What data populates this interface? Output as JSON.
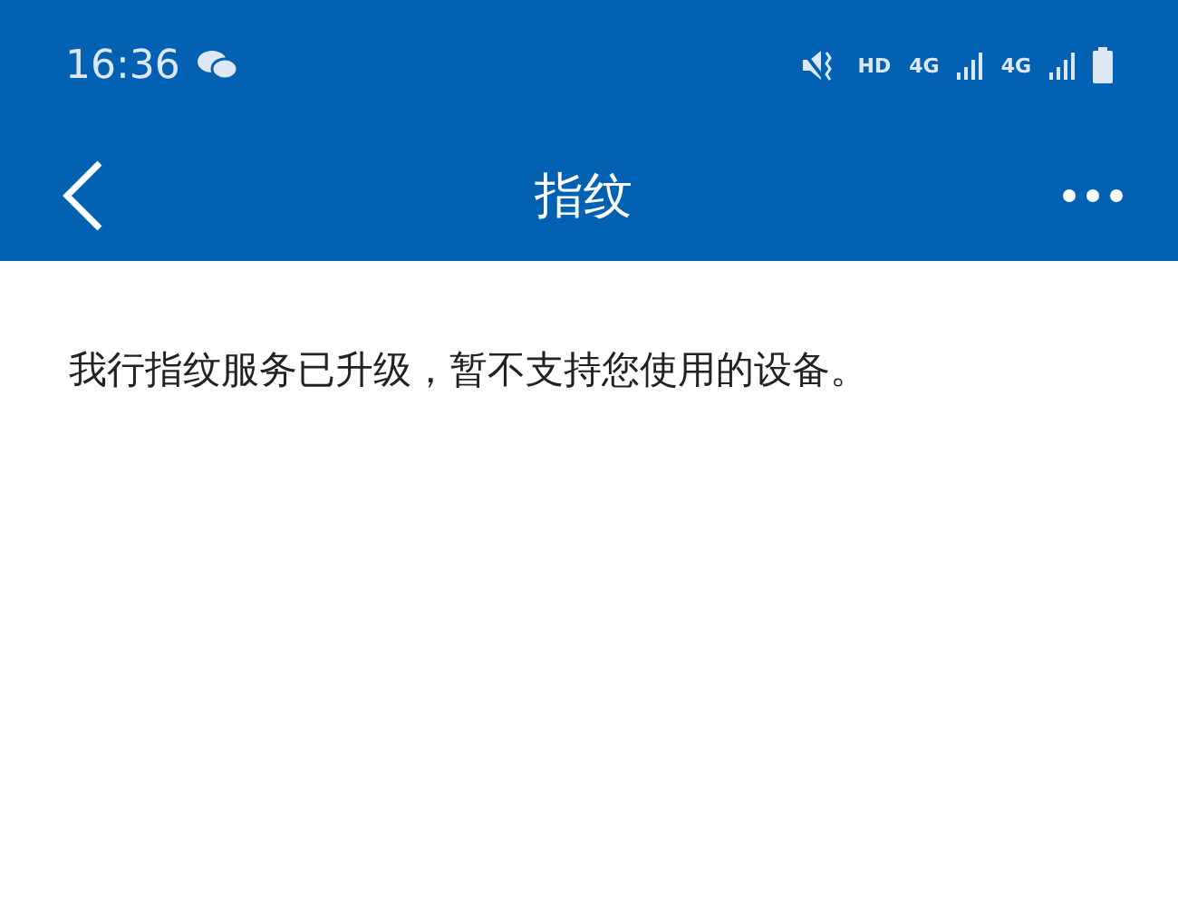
{
  "status_bar": {
    "time": "16:36",
    "hd": "HD",
    "network_1": "4G",
    "network_2": "4G"
  },
  "header": {
    "title": "指纹"
  },
  "message": "我行指纹服务已升级，暂不支持您使用的设备。"
}
